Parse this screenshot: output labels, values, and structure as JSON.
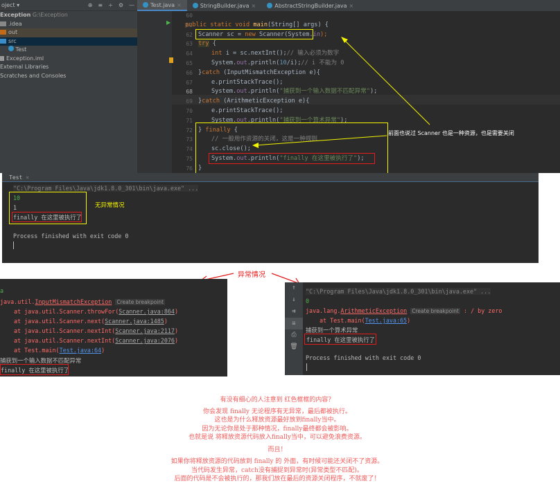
{
  "ide": {
    "sidebar": {
      "title": "oject",
      "tree": [
        {
          "label": "Exception",
          "hint": "G:\\Exception"
        },
        {
          "label": ".idea"
        },
        {
          "label": "out"
        },
        {
          "label": "src"
        },
        {
          "label": "Test"
        },
        {
          "label": "Exception.iml"
        },
        {
          "label": "External Libraries"
        },
        {
          "label": "Scratches and Consoles"
        }
      ]
    },
    "tabs": [
      {
        "label": "Test.java"
      },
      {
        "label": "StringBuilder.java"
      },
      {
        "label": "AbstractStringBuilder.java"
      }
    ],
    "line_numbers": [
      "60",
      "61",
      "62",
      "63",
      "64",
      "65",
      "66",
      "67",
      "68",
      "69",
      "70",
      "71",
      "72",
      "73",
      "74",
      "75",
      "76"
    ],
    "code": {
      "l61": [
        "public static void ",
        "main",
        "(String[] args) {"
      ],
      "l62": [
        "Scanner sc = ",
        "new",
        " Scanner(System.",
        "in",
        ");"
      ],
      "l63": [
        "try",
        " {"
      ],
      "l64": [
        "int",
        " i = sc.nextInt();",
        "// 输入必须为数字"
      ],
      "l65": [
        "System.",
        "out",
        ".println(",
        "10",
        "/i);",
        "// i 不能为 0"
      ],
      "l66": [
        "}",
        "catch",
        " (InputMismatchException e){"
      ],
      "l67": "e.printStackTrace();",
      "l68": [
        "System.",
        "out",
        ".println(",
        "\"捕获到一个输入数据不匹配异常\"",
        ");"
      ],
      "l69": [
        "}",
        "catch",
        " (ArithmeticException e){"
      ],
      "l70": "e.printStackTrace();",
      "l71": [
        "System.",
        "out",
        ".println(",
        "\"捕获到一个算术异常\"",
        ");"
      ],
      "l72": [
        "} ",
        "finally",
        " {"
      ],
      "l73": "// 一般用作资源的关闭，这是一种规则",
      "l74": "sc.close();",
      "l75": [
        "System.",
        "out",
        ".println(",
        "\"finally 在这里被执行了\"",
        ");"
      ],
      "l76": "}"
    },
    "annotation": "前面也说过 Scanner 也是一种资源，也是需要关闭"
  },
  "run": {
    "tab": "Test",
    "cmd": "\"C:\\Program Files\\Java\\jdk1.8.0_301\\bin\\java.exe\" ...",
    "lines": [
      "10",
      "1",
      "finally 在这里被执行了"
    ],
    "finished": "Process finished with exit code 0",
    "note": "无异常情况"
  },
  "exception_label": "异常情况",
  "left_console": {
    "input": "a",
    "exception_pkg": "java.util.",
    "exception": "InputMismatchException",
    "bp": "Create breakpoint",
    "stack": [
      [
        "at java.util.Scanner.throwFor(",
        "Scanner.java:864",
        ")"
      ],
      [
        "at java.util.Scanner.next(",
        "Scanner.java:1485",
        ")"
      ],
      [
        "at java.util.Scanner.nextInt(",
        "Scanner.java:2117",
        ")"
      ],
      [
        "at java.util.Scanner.nextInt(",
        "Scanner.java:2076",
        ")"
      ],
      [
        "at Test.main(",
        "Test.java:64",
        ")"
      ]
    ],
    "msg": "捕获到一个输入数据不匹配异常",
    "finally": "finally 在这里被执行了"
  },
  "right_console": {
    "cmd": "\"C:\\Program Files\\Java\\jdk1.8.0_301\\bin\\java.exe\" ...",
    "input": "0",
    "exception_pkg": "java.lang.",
    "exception": "ArithmeticException",
    "bp": "Create breakpoint",
    "detail": ": / by zero",
    "stack": [
      "at Test.main(",
      "Test.java:65",
      ")"
    ],
    "msg": "捕获到一个算术异常",
    "finally": "finally 在这里被执行了",
    "finished": "Process finished with exit code 0",
    "toolbar": [
      "up-arrow-icon",
      "down-arrow-icon",
      "soft-wrap-icon",
      "scroll-to-end-icon",
      "print-icon",
      "trash-icon"
    ]
  },
  "notes": [
    "有没有细心的人注意到 红色框框的内容？",
    "你会发现 finally 无论程序有无异常，最后都被执行。",
    "这也是为什么释放资源最好放到finally当中。",
    "因为无论你是处于那种情况，finally最终都会被影响。",
    "也就是说 将释放资源代码放入finally当中，可以避免浪费资源。",
    "而且！",
    "如果你将释放资源的代码放到 finally 的 外面，有时候可能还关闭不了资源。",
    "当代码发生异常，catch没有捕捉到异常时(异常类型不匹配)。",
    "后面的代码是不会被执行的，那我们放在最后的资源关闭程序，不就废了！"
  ],
  "colors": {
    "highlight_box": "#f5f500",
    "red_box": "#e31c1c",
    "note_text": "#f25b5b"
  }
}
